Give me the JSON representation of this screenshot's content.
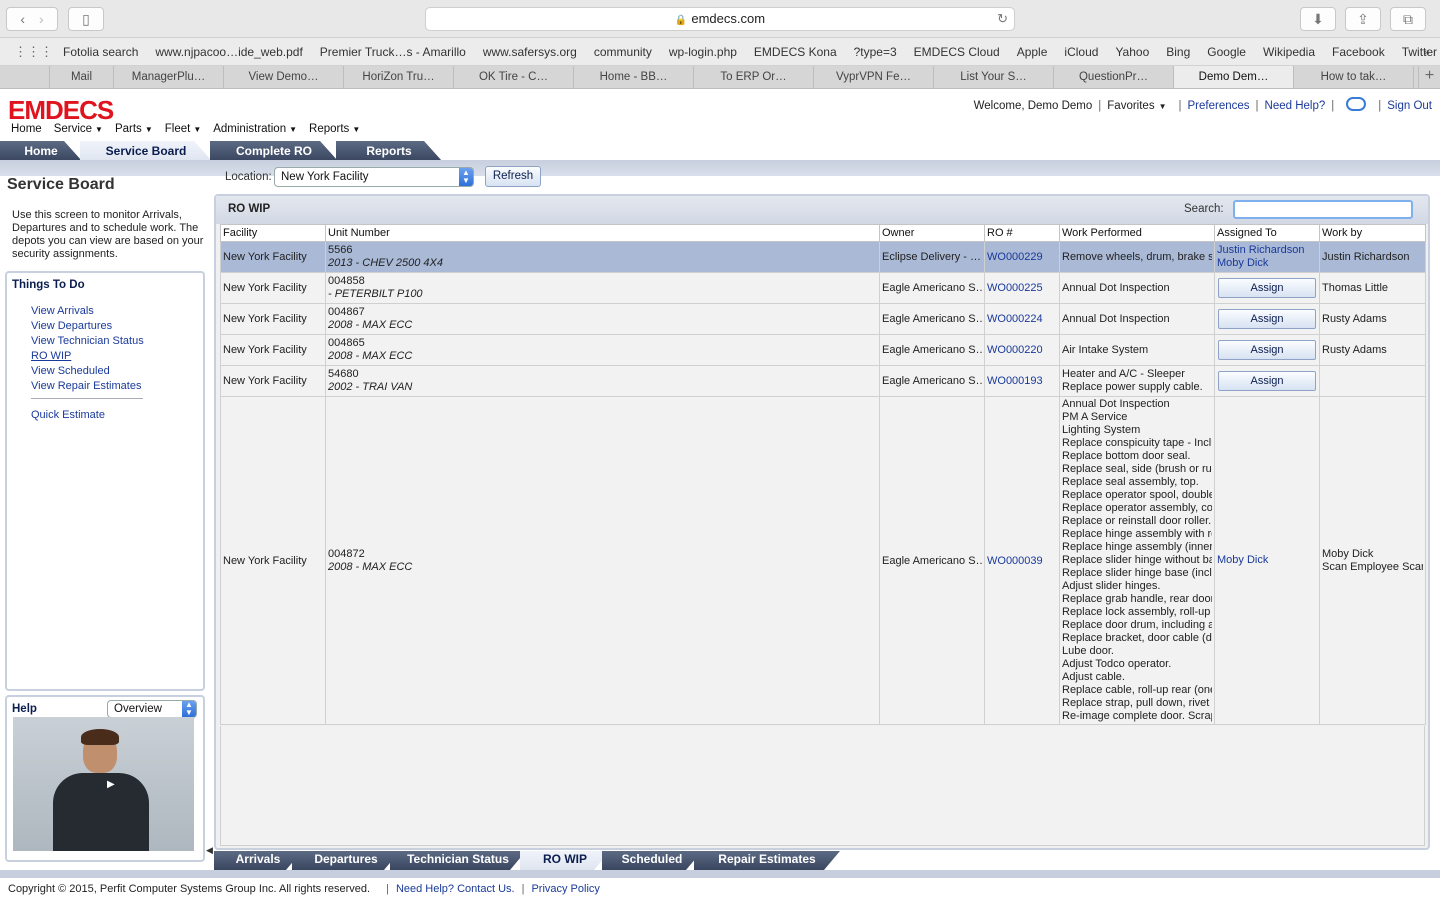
{
  "browser": {
    "url": "emdecs.com",
    "favorites": [
      "Fotolia search",
      "www.njpacoo…ide_web.pdf",
      "Premier Truck…s - Amarillo",
      "www.safersys.org",
      "community",
      "wp-login.php",
      "EMDECS Kona",
      "?type=3",
      "EMDECS Cloud",
      "Apple",
      "iCloud",
      "Yahoo",
      "Bing",
      "Google",
      "Wikipedia",
      "Facebook",
      "Twitter"
    ],
    "tabs": [
      "Mail",
      "ManagerPlu…",
      "View Demo…",
      "HoriZon Tru…",
      "OK Tire - C…",
      "Home - BB…",
      "To ERP Or…",
      "VyprVPN Fe…",
      "List Your S…",
      "QuestionPr…",
      "Demo Dem…",
      "How to tak…"
    ],
    "active_tab_index": 10
  },
  "app": {
    "logo": "EMDECS",
    "welcome": "Welcome, Demo Demo",
    "favorites_label": "Favorites",
    "preferences": "Preferences",
    "need_help": "Need Help?",
    "sign_out": "Sign Out",
    "menu": [
      "Home",
      "Service",
      "Parts",
      "Fleet",
      "Administration",
      "Reports"
    ],
    "top_tabs": [
      "Home",
      "Service Board",
      "Complete RO",
      "Reports"
    ],
    "active_top_tab": "Service Board"
  },
  "sidebar": {
    "title": "Service Board",
    "description": "Use this screen to monitor Arrivals, Departures and to schedule work. The depots you can view are based on your security assignments.",
    "things_title": "Things To Do",
    "links": [
      "View Arrivals",
      "View Departures",
      "View Technician Status",
      "RO WIP",
      "View Scheduled",
      "View Repair Estimates"
    ],
    "quick_estimate": "Quick Estimate",
    "help_title": "Help",
    "help_select": "Overview"
  },
  "location": {
    "label": "Location:",
    "value": "New York Facility",
    "refresh": "Refresh"
  },
  "panel": {
    "title": "RO WIP",
    "search_label": "Search:",
    "search_value": "",
    "columns": [
      "Facility",
      "Unit Number",
      "Owner",
      "RO #",
      "Work Performed",
      "Assigned To",
      "Work by"
    ],
    "assign_label": "Assign",
    "rows": [
      {
        "facility": "New York Facility",
        "unit": "5566",
        "unit_desc": "2013 - CHEV 2500 4X4",
        "owner": "Eclipse Delivery - …",
        "ro": "WO000229",
        "work": [
          "Remove wheels, drum, brake shoes"
        ],
        "assigned": [
          "Justin Richardson",
          "Moby Dick"
        ],
        "workby": [
          "Justin Richardson"
        ]
      },
      {
        "facility": "New York Facility",
        "unit": "004858",
        "unit_desc": "- PETERBILT P100",
        "owner": "Eagle Americano S…",
        "ro": "WO000225",
        "work": [
          "Annual Dot Inspection"
        ],
        "assigned": [],
        "workby": [
          "Thomas Little"
        ]
      },
      {
        "facility": "New York Facility",
        "unit": "004867",
        "unit_desc": "2008 - MAX ECC",
        "owner": "Eagle Americano S…",
        "ro": "WO000224",
        "work": [
          "Annual Dot Inspection"
        ],
        "assigned": [],
        "workby": [
          "Rusty Adams"
        ]
      },
      {
        "facility": "New York Facility",
        "unit": "004865",
        "unit_desc": "2008 - MAX ECC",
        "owner": "Eagle Americano S…",
        "ro": "WO000220",
        "work": [
          "Air Intake System"
        ],
        "assigned": [],
        "workby": [
          "Rusty Adams"
        ]
      },
      {
        "facility": "New York Facility",
        "unit": "54680",
        "unit_desc": "2002 - TRAI VAN",
        "owner": "Eagle Americano S…",
        "ro": "WO000193",
        "work": [
          "Heater and A/C - Sleeper",
          "Replace power supply cable."
        ],
        "assigned": [],
        "workby": []
      },
      {
        "facility": "New York Facility",
        "unit": "004872",
        "unit_desc": "2008 - MAX ECC",
        "owner": "Eagle Americano S…",
        "ro": "WO000039",
        "work": [
          "Annual Dot Inspection",
          "PM A Service",
          "Lighting System",
          "Replace conspicuity tape - Inclu",
          "Replace bottom door seal.",
          "Replace seal, side (brush or rub",
          "Replace seal assembly, top.",
          "Replace operator spool, double",
          "Replace operator assembly, com",
          "Replace or reinstall door roller.",
          "Replace hinge assembly with ro",
          "Replace hinge assembly (inner)",
          "Replace slider hinge without ba",
          "Replace slider hinge base (inclu",
          "Adjust slider hinges.",
          "Replace grab handle, rear door",
          "Replace lock assembly, roll-up r",
          "Replace door drum, including a",
          "Replace bracket, door cable (do",
          "Lube door.",
          "Adjust Todco operator.",
          "Adjust cable.",
          "Replace cable, roll-up rear (one",
          "Replace strap, pull down, rivet",
          "Re-image complete door. Scrap"
        ],
        "assigned": [
          "Moby Dick"
        ],
        "workby": [
          "Moby Dick",
          "Scan Employee Scan"
        ]
      }
    ]
  },
  "bottom_tabs": [
    "Arrivals",
    "Departures",
    "Technician Status",
    "RO WIP",
    "Scheduled",
    "Repair Estimates"
  ],
  "active_bottom_tab": "RO WIP",
  "footer": {
    "copyright": "Copyright © 2015, Perfit Computer Systems Group Inc. All rights reserved.",
    "contact": "Need Help? Contact Us.",
    "privacy": "Privacy Policy"
  }
}
